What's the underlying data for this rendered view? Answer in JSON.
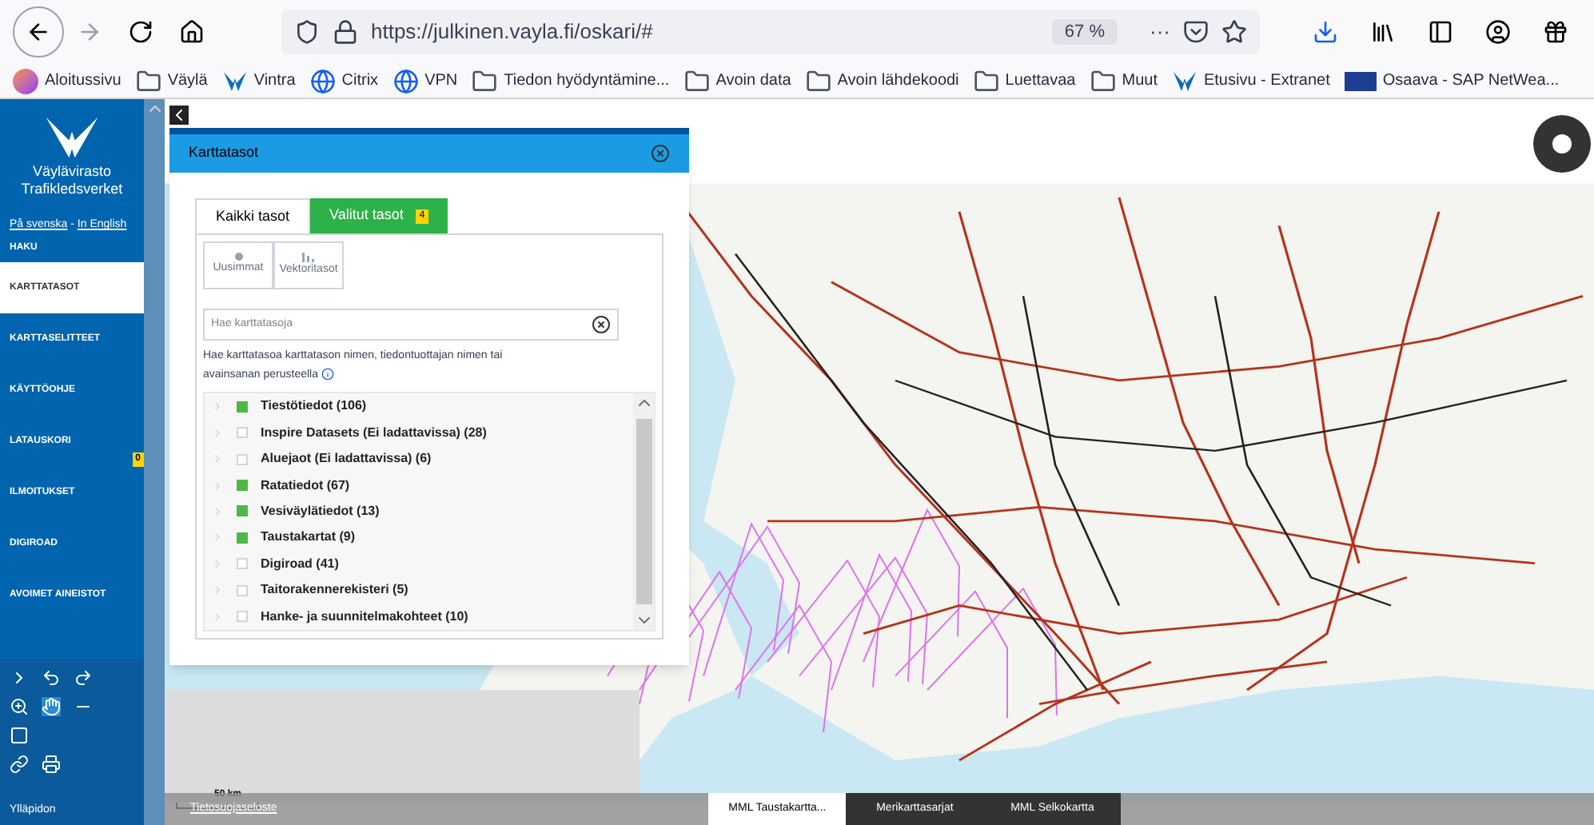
{
  "browser": {
    "url": "https://julkinen.vayla.fi/oskari/#",
    "zoom": "67 %",
    "more": "···",
    "bookmarks": [
      {
        "label": "Aloitussivu",
        "kind": "firefox"
      },
      {
        "label": "Väylä",
        "kind": "folder"
      },
      {
        "label": "Vintra",
        "kind": "vayla"
      },
      {
        "label": "Citrix",
        "kind": "globe"
      },
      {
        "label": "VPN",
        "kind": "globe"
      },
      {
        "label": "Tiedon hyödyntämine...",
        "kind": "folder"
      },
      {
        "label": "Avoin data",
        "kind": "folder"
      },
      {
        "label": "Avoin lähdekoodi",
        "kind": "folder"
      },
      {
        "label": "Luettavaa",
        "kind": "folder"
      },
      {
        "label": "Muut",
        "kind": "folder"
      },
      {
        "label": "Etusivu - Extranet",
        "kind": "vayla"
      },
      {
        "label": "Osaava - SAP NetWea...",
        "kind": "sap"
      }
    ]
  },
  "sidebar": {
    "org": [
      "Väylävirasto",
      "Trafikledsverket"
    ],
    "lang_links": [
      "På svenska",
      "In English"
    ],
    "lang_sep": " - ",
    "items": [
      {
        "label": "HAKU",
        "selected": false
      },
      {
        "label": "KARTTATASOT",
        "selected": true
      },
      {
        "label": "KARTTASELITTEET",
        "selected": false
      },
      {
        "label": "KÄYTTÖOHJE",
        "selected": false
      },
      {
        "label": "LATAUSKORI",
        "selected": false,
        "badge": "0"
      },
      {
        "label": "ILMOITUKSET",
        "selected": false
      },
      {
        "label": "DIGIROAD",
        "selected": false
      },
      {
        "label": "AVOIMET AINEISTOT",
        "selected": false
      }
    ],
    "footer": "Ylläpidon"
  },
  "panel": {
    "title": "Karttatasot",
    "tabs": [
      {
        "label": "Kaikki tasot",
        "selected": true
      },
      {
        "label": "Valitut tasot",
        "selected": false,
        "badge": "4"
      }
    ],
    "filters": [
      {
        "label": "Uusimmat",
        "kind": "dot"
      },
      {
        "label": "Vektoritasot",
        "kind": "bars"
      }
    ],
    "search": {
      "placeholder": "Hae karttatasoja"
    },
    "help": "Hae karttatasoa karttatason nimen, tiedontuottajan nimen tai avainsanan perusteella",
    "groups": [
      {
        "label": "Tiestötiedot (106)",
        "checked": true
      },
      {
        "label": "Inspire Datasets (Ei ladattavissa) (28)",
        "checked": false
      },
      {
        "label": "Aluejaot (Ei ladattavissa) (6)",
        "checked": false
      },
      {
        "label": "Ratatiedot (67)",
        "checked": true
      },
      {
        "label": "Vesiväylätiedot (13)",
        "checked": true
      },
      {
        "label": "Taustakartat (9)",
        "checked": true
      },
      {
        "label": "Digiroad (41)",
        "checked": false
      },
      {
        "label": "Taitorakennerekisteri (5)",
        "checked": false
      },
      {
        "label": "Hanke- ja suunnitelmakohteet (10)",
        "checked": false
      }
    ]
  },
  "map": {
    "scale": "50 km",
    "footer_link": "Tietosuojaseloste",
    "layers": [
      {
        "label": "MML Taustakartta...",
        "selected": true
      },
      {
        "label": "Merikarttasarjat",
        "selected": false
      },
      {
        "label": "MML Selkokartta",
        "selected": false
      }
    ]
  }
}
